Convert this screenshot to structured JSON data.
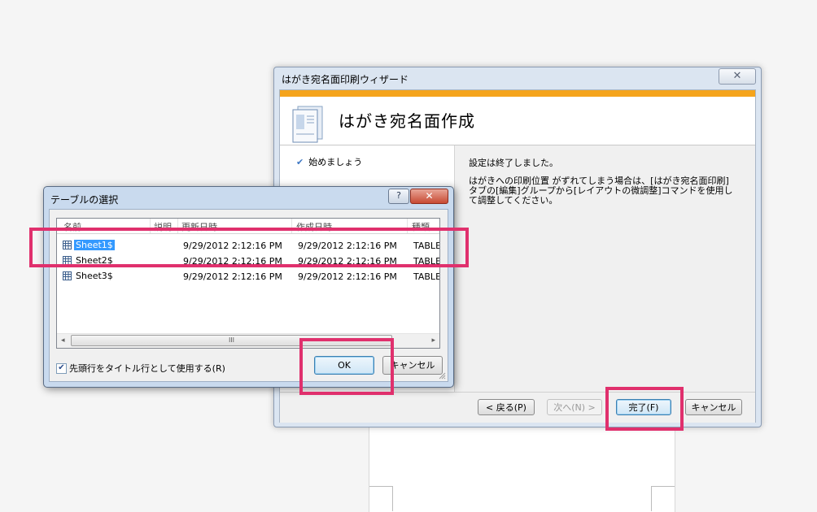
{
  "wizard": {
    "title": "はがき宛名面印刷ウィザード",
    "close_glyph": "✕",
    "header_title": "はがき宛名面作成",
    "steps": [
      {
        "label": "始めましょう",
        "check": "✔"
      }
    ],
    "message_line1": "設定は終了しました。",
    "message_line2": "はがきへの印刷位置 がずれてしまう場合は、[はがき宛名面印刷]タブの[編集]グループから[レイアウトの微調整]コマンドを使用して調整してください。",
    "buttons": {
      "back": "< 戻る(P)",
      "next": "次へ(N) >",
      "finish": "完了(F)",
      "cancel": "キャンセル"
    }
  },
  "dialog": {
    "title": "テーブルの選択",
    "help_glyph": "?",
    "close_glyph": "✕",
    "columns": [
      "名前",
      "説明",
      "更新日時",
      "作成日時",
      "種類"
    ],
    "rows": [
      {
        "name": "Sheet1$",
        "modified": "9/29/2012 2:12:16 PM",
        "created": "9/29/2012 2:12:16 PM",
        "type": "TABLE",
        "selected": true
      },
      {
        "name": "Sheet2$",
        "modified": "9/29/2012 2:12:16 PM",
        "created": "9/29/2012 2:12:16 PM",
        "type": "TABLE",
        "selected": false
      },
      {
        "name": "Sheet3$",
        "modified": "9/29/2012 2:12:16 PM",
        "created": "9/29/2012 2:12:16 PM",
        "type": "TABLE",
        "selected": false
      }
    ],
    "scroll_thumb_glyph": "III",
    "scroll_left": "◂",
    "scroll_right": "▸",
    "checkbox_label": "先頭行をタイトル行として使用する(R)",
    "checkbox_checked": true,
    "check_glyph": "✔",
    "ok_label": "OK",
    "cancel_label": "キャンセル"
  },
  "colors": {
    "highlight": "#e0306d",
    "selection": "#3399ff",
    "wizard_header_accent": "#f5a41c"
  },
  "icons": [
    "wizard-document-icon",
    "table-icon",
    "resize-grip-icon",
    "checkmark-icon"
  ]
}
